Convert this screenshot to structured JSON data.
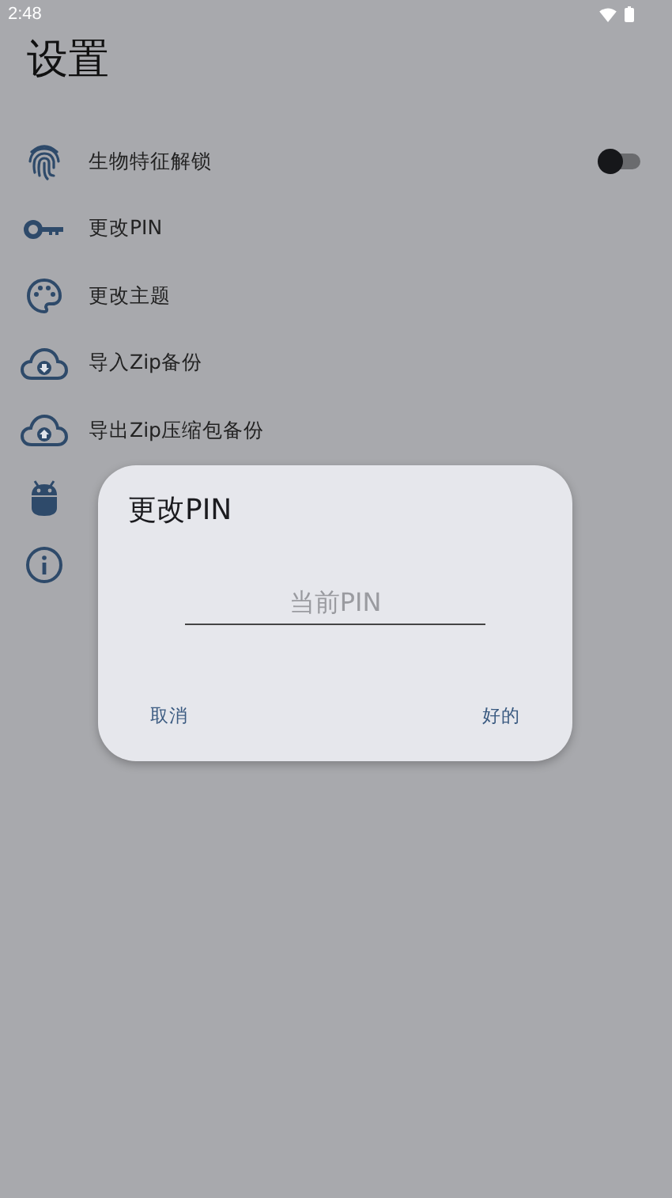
{
  "status_bar": {
    "time": "2:48"
  },
  "title": "设置",
  "items": [
    {
      "kind": "switch",
      "label": "生物特征解锁",
      "on": false
    },
    {
      "kind": "link",
      "label": "更改PIN"
    },
    {
      "kind": "link",
      "label": "更改主题"
    },
    {
      "kind": "link",
      "label": "导入Zip备份"
    },
    {
      "kind": "link",
      "label": "导出Zip压缩包备份"
    },
    {
      "kind": "link"
    },
    {
      "kind": "link"
    }
  ],
  "dialog": {
    "title": "更改PIN",
    "field": {
      "placeholder": "当前PIN"
    },
    "buttons": [
      "取消",
      "好的"
    ]
  }
}
